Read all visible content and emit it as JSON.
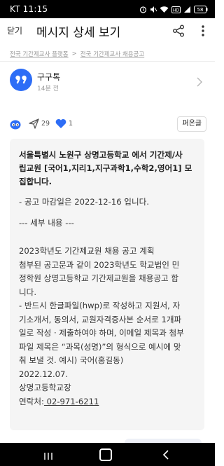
{
  "status_bar": {
    "carrier_time": "KT 11:15",
    "battery": "58"
  },
  "header": {
    "close_label": "닫기",
    "title": "메시지 상세 보기"
  },
  "breadcrumb": {
    "items": [
      "전국 기간제교사 플랫폼",
      "전국 기간제교사 채용공고"
    ]
  },
  "author": {
    "name": "구구톡",
    "time": "14분 전"
  },
  "actions": {
    "send_count": "29",
    "heart_count": "1",
    "repost_label": "퍼온글"
  },
  "post": {
    "title_lines": [
      "서울특별시 노원구 상명고등학교 에서 기간제/사",
      "립교원 [국어1,지리1,지구과학1,수학2,영어1] 모",
      "집합니다."
    ],
    "deadline": "- 공고 마감일은 2022-12-16 입니다.",
    "detail_heading": "--- 세부 내용 ---",
    "body_lines": [
      "2023학년도 기간제교원 채용 공고 계획",
      "첨부된 공고문과 같이 2023학년도 학교법인 민",
      "정학원 상명고등학교 기간제교원을 채용공고 합",
      "니다.",
      "- 반드시 한글파일(hwp)로 작성하고 지원서, 자",
      "기소개서, 동의서, 교원자격증사본 순서로 1개파",
      "일로 작성 · 제출하여야 하며, 이메일 제목과 첨부",
      "파일 제목은 “과목(성명)”의 형식으로 예시에 맞",
      "춰 보낼 것. 예시) 국어(홍길동)",
      "2022.12.07.",
      "상명고등학교장"
    ],
    "contact_label": "연락처:",
    "contact_number": " 02-971-6211"
  },
  "colors": {
    "accent": "#2d6df6",
    "card_bg": "#f5f5f5",
    "muted": "#9a9a9a"
  }
}
